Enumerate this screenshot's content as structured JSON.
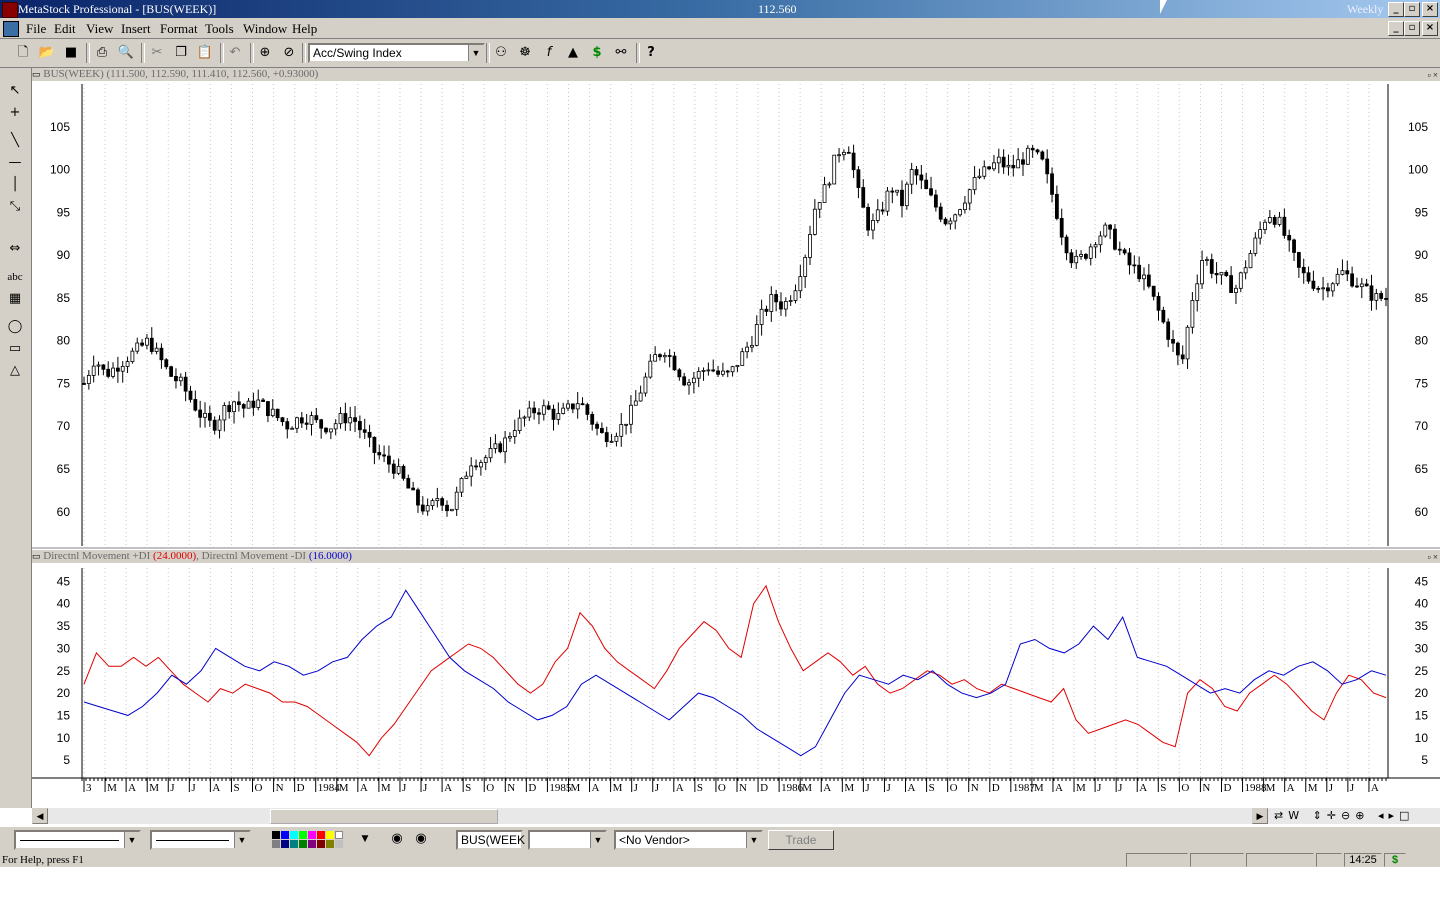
{
  "window": {
    "title": "MetaStock Professional - [BUS(WEEK)]",
    "center_value": "112.560",
    "period": "Weekly"
  },
  "menu": [
    "File",
    "Edit",
    "View",
    "Insert",
    "Format",
    "Tools",
    "Window",
    "Help"
  ],
  "toolbar": {
    "indicator_select": "Acc/Swing Index"
  },
  "price_pane": {
    "header": "BUS(WEEK) (111.500, 112.590, 111.410, 112.560, +0.93000)"
  },
  "indicator_pane": {
    "label_plus": "Directnl Movement +DI",
    "value_plus": "(24.0000)",
    "sep": ",",
    "label_minus": "Directnl Movement -DI",
    "value_minus": "(16.0000)"
  },
  "bottom": {
    "symbol": "BUS(WEEK",
    "vendor": "<No Vendor>",
    "trade_label": "Trade"
  },
  "status": {
    "help": "For Help, press F1",
    "time": "14:25",
    "dollar": "$"
  },
  "colors": {
    "plus_di": "#e00000",
    "minus_di": "#0000cc"
  },
  "chart_data": [
    {
      "type": "candlestick",
      "title": "",
      "ylim": [
        56,
        110
      ],
      "y_ticks": [
        60,
        65,
        70,
        75,
        80,
        85,
        90,
        95,
        100,
        105
      ],
      "x_tick_labels": [
        "3",
        "M",
        "A",
        "M",
        "J",
        "J",
        "A",
        "S",
        "O",
        "N",
        "D",
        "1984",
        "M",
        "A",
        "M",
        "J",
        "J",
        "A",
        "S",
        "O",
        "N",
        "D",
        "1985",
        "M",
        "A",
        "M",
        "J",
        "J",
        "A",
        "S",
        "O",
        "N",
        "D",
        "1986",
        "M",
        "A",
        "M",
        "J",
        "J",
        "A",
        "S",
        "O",
        "N",
        "D",
        "1987",
        "M",
        "A",
        "M",
        "J",
        "J",
        "A",
        "S",
        "O",
        "N",
        "D",
        "1988",
        "M",
        "A",
        "M",
        "J",
        "J",
        "A"
      ],
      "close_series": [
        75,
        78,
        76,
        77,
        78,
        79,
        80,
        78,
        76,
        75,
        73,
        71,
        70,
        72,
        73,
        72,
        73,
        72,
        71,
        70,
        71,
        71,
        70,
        70,
        71,
        71,
        69,
        67,
        66,
        65,
        63,
        61,
        60,
        62,
        60,
        63,
        66,
        66,
        67,
        68,
        70,
        71,
        72,
        72,
        71,
        72,
        73,
        71,
        69,
        69,
        70,
        72,
        75,
        78,
        79,
        77,
        75,
        76,
        77,
        76,
        76,
        78,
        80,
        83,
        85,
        84,
        86,
        90,
        96,
        98,
        102,
        103,
        97,
        93,
        95,
        98,
        96,
        100,
        98,
        96,
        94,
        95,
        97,
        99,
        100,
        101,
        100,
        101,
        102,
        101,
        97,
        92,
        89,
        90,
        92,
        93,
        91,
        89,
        88,
        86,
        83,
        80,
        77,
        85,
        90,
        88,
        87,
        86,
        89,
        92,
        95,
        94,
        91,
        88,
        87,
        86,
        87,
        88,
        87,
        86,
        85,
        85
      ]
    },
    {
      "type": "line",
      "title": "",
      "ylim": [
        1,
        48
      ],
      "y_ticks": [
        5,
        10,
        15,
        20,
        25,
        30,
        35,
        40,
        45
      ],
      "series": [
        {
          "name": "Directnl Movement +DI",
          "values": [
            22,
            29,
            26,
            26,
            28,
            26,
            28,
            25,
            22,
            20,
            18,
            21,
            20,
            22,
            21,
            20,
            18,
            18,
            17,
            15,
            13,
            11,
            9,
            6,
            10,
            13,
            17,
            21,
            25,
            27,
            29,
            31,
            30,
            28,
            25,
            22,
            20,
            22,
            27,
            30,
            38,
            35,
            30,
            27,
            25,
            23,
            21,
            25,
            30,
            33,
            36,
            34,
            30,
            28,
            40,
            44,
            36,
            30,
            25,
            27,
            29,
            27,
            24,
            26,
            22,
            20,
            21,
            23,
            25,
            24,
            22,
            23,
            21,
            20,
            22,
            21,
            20,
            19,
            18,
            21,
            14,
            11,
            12,
            13,
            14,
            13,
            11,
            9,
            8,
            20,
            23,
            21,
            17,
            16,
            20,
            22,
            24,
            22,
            19,
            16,
            14,
            20,
            24,
            23,
            20,
            19
          ]
        },
        {
          "name": "Directnl Movement -DI",
          "values": [
            18,
            17,
            16,
            15,
            17,
            20,
            24,
            22,
            25,
            30,
            28,
            26,
            25,
            27,
            26,
            24,
            25,
            27,
            28,
            32,
            35,
            37,
            43,
            38,
            33,
            28,
            25,
            23,
            21,
            18,
            16,
            14,
            15,
            17,
            22,
            24,
            22,
            20,
            18,
            16,
            14,
            17,
            20,
            19,
            17,
            15,
            12,
            10,
            8,
            6,
            8,
            14,
            20,
            24,
            23,
            22,
            24,
            23,
            25,
            22,
            20,
            19,
            20,
            22,
            31,
            32,
            30,
            29,
            31,
            35,
            32,
            37,
            28,
            27,
            26,
            24,
            22,
            20,
            21,
            20,
            23,
            25,
            24,
            26,
            27,
            25,
            22,
            23,
            25,
            24
          ]
        }
      ]
    }
  ]
}
